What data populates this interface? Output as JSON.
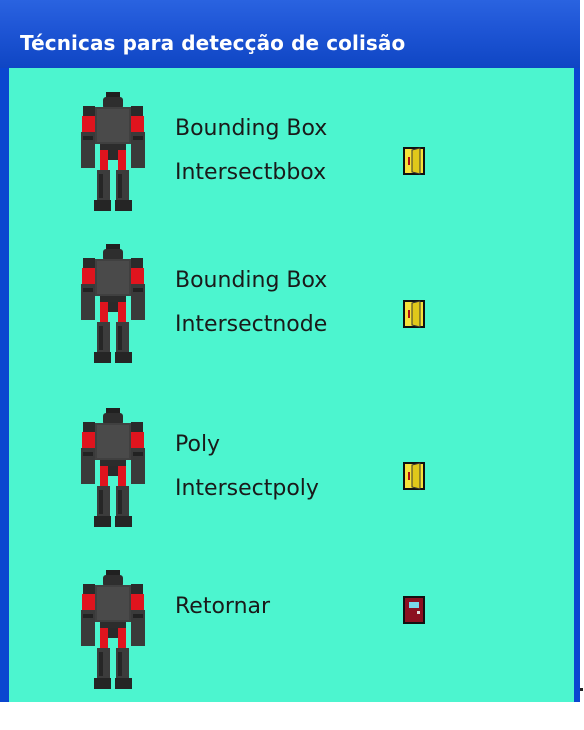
{
  "window": {
    "title": "Técnicas para detecção de colisão"
  },
  "colors": {
    "title_bar": "#1f56d6",
    "background": "#4cf5cf",
    "robot_body": "#3a3a3a",
    "robot_accent": "#e0141e",
    "door_open": "#f7e23a",
    "door_closed": "#8b1020"
  },
  "menu": {
    "items": [
      {
        "line1": "Bounding Box",
        "line2": "Intersectbbox",
        "icon": "robot-icon",
        "action_icon": "open-door-icon"
      },
      {
        "line1": "Bounding Box",
        "line2": "Intersectnode",
        "icon": "robot-icon",
        "action_icon": "open-door-icon"
      },
      {
        "line1": "Poly",
        "line2": "Intersectpoly",
        "icon": "robot-icon",
        "action_icon": "open-door-icon"
      },
      {
        "line1": "Retornar",
        "icon": "robot-icon",
        "action_icon": "closed-door-icon"
      }
    ]
  }
}
